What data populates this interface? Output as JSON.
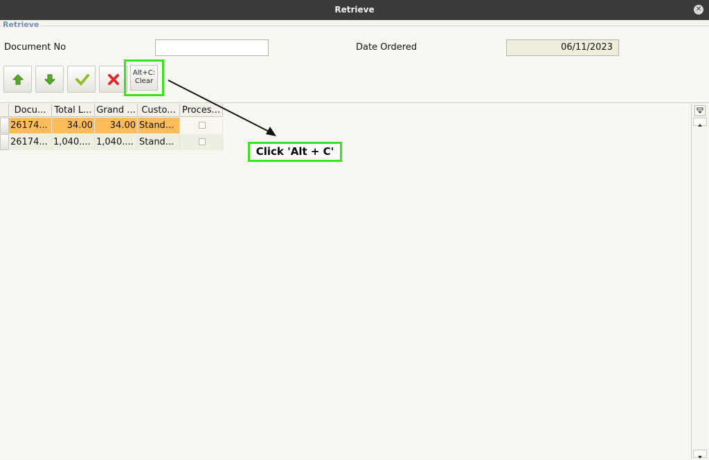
{
  "window": {
    "title": "Retrieve"
  },
  "section": {
    "legend": "Retrieve"
  },
  "form": {
    "document_no_label": "Document No",
    "document_no_value": "",
    "date_ordered_label": "Date Ordered",
    "date_ordered_value": "06/11/2023"
  },
  "toolbar": {
    "clear_line1": "Alt+C:",
    "clear_line2": "Clear",
    "icons": [
      "arrow-up-icon",
      "arrow-down-icon",
      "checkmark-icon",
      "cross-icon"
    ]
  },
  "table": {
    "columns": [
      "Docu...",
      "Total L...",
      "Grand ...",
      "Custo...",
      "Proces..."
    ],
    "rows": [
      {
        "document": "26174...",
        "total_lines": "34.00",
        "grand_total": "34.00",
        "customer": "Stand...",
        "processed": false,
        "selected": true
      },
      {
        "document": "26174...",
        "total_lines": "1,040....",
        "grand_total": "1,040....",
        "customer": "Stand...",
        "processed": false,
        "selected": false
      }
    ]
  },
  "annotation": {
    "text": "Click 'Alt + C'"
  },
  "colors": {
    "highlight": "#37e31d",
    "selected_row": "#ffbc5a",
    "title_bar": "#3a3a38"
  }
}
